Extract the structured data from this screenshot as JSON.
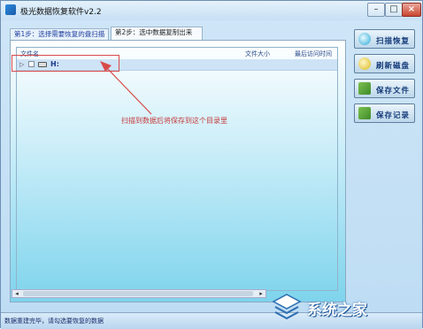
{
  "window": {
    "title": "极光数据恢复软件v2.2"
  },
  "tabs": [
    {
      "label": "第1步：选择需要恢复的盘扫描"
    },
    {
      "label": "第2步：选中数据复制出来"
    }
  ],
  "file_list": {
    "columns": {
      "name": "文件名",
      "size": "文件大小",
      "time": "最后访问时间"
    },
    "rows": [
      {
        "name": "H:",
        "expander": "▷"
      }
    ]
  },
  "annotation": "扫描到数据后将保存到这个目录里",
  "side_buttons": [
    {
      "label": "扫描恢复",
      "icon": "magnifier-icon"
    },
    {
      "label": "刷新磁盘",
      "icon": "refresh-disk-icon"
    },
    {
      "label": "保存文件",
      "icon": "save-file-icon"
    },
    {
      "label": "保存记录",
      "icon": "save-record-icon"
    }
  ],
  "status": "数据重建完毕，请勾选要恢复的数据",
  "watermark": {
    "text": "系统之家"
  },
  "colors": {
    "accent": "#2040a0",
    "annotation_red": "#d84a4a"
  }
}
